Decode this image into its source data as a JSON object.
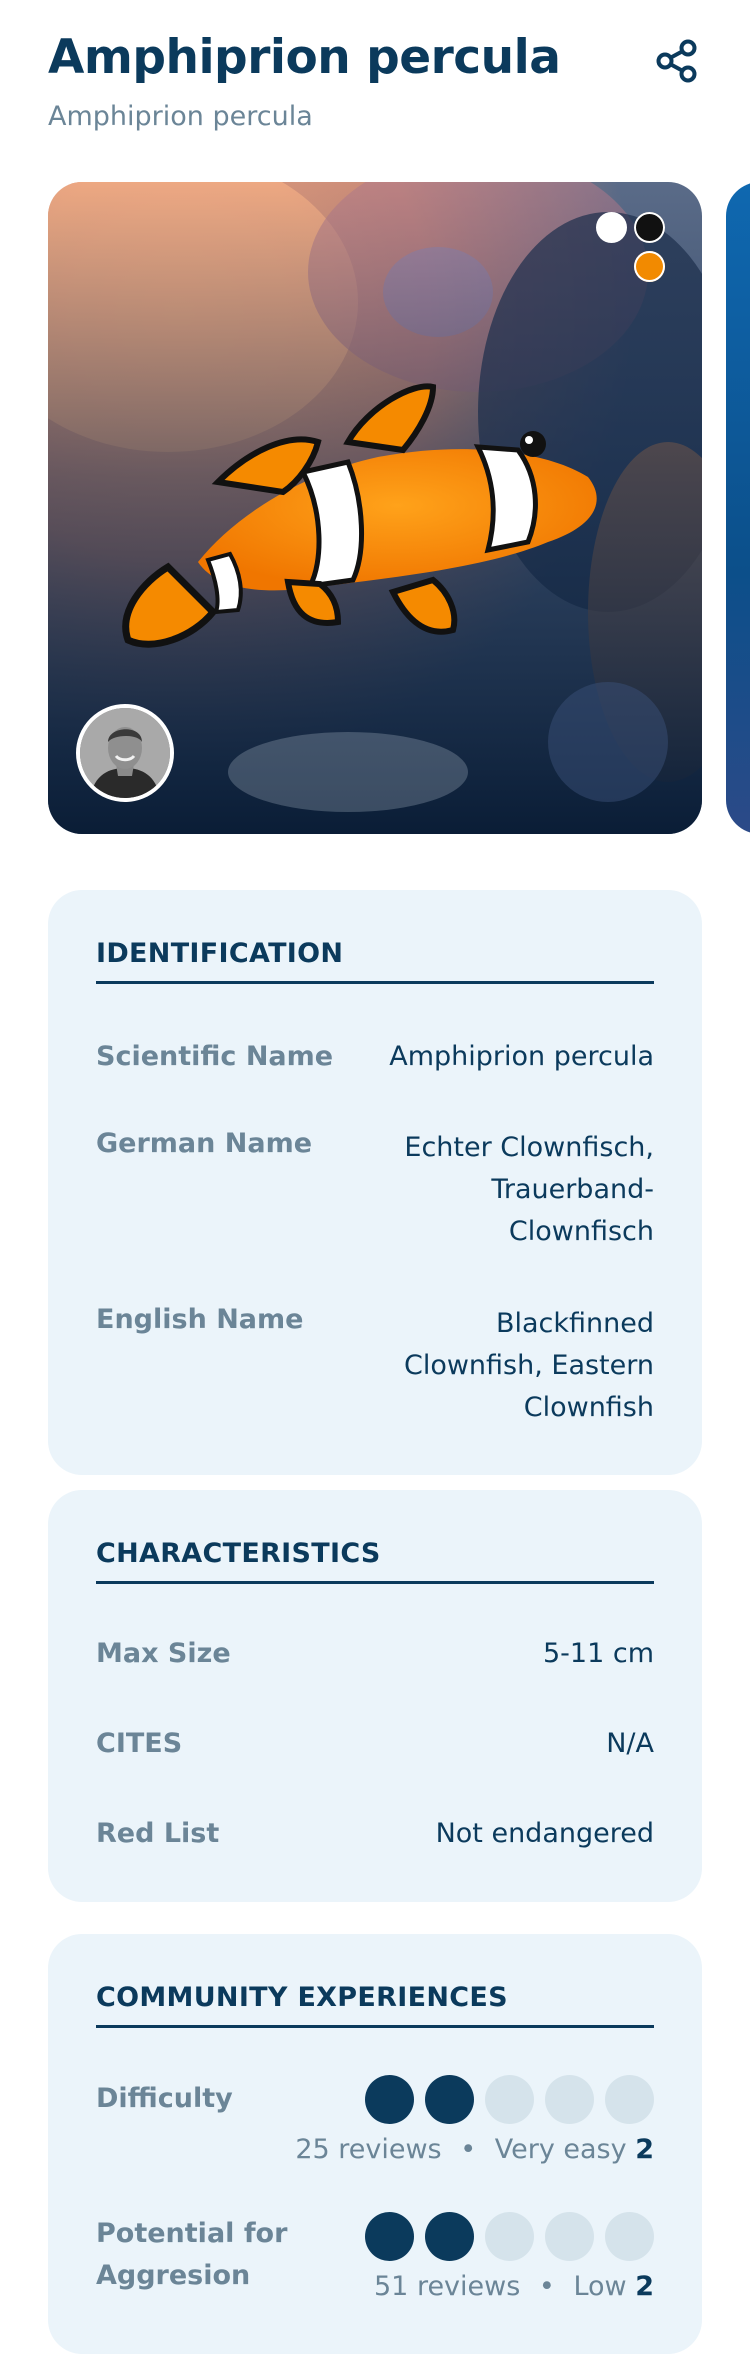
{
  "header": {
    "title": "Amphiprion percula",
    "subtitle": "Amphiprion percula"
  },
  "gallery": {
    "dots": [
      "white",
      "black",
      "orange"
    ]
  },
  "identification": {
    "title": "IDENTIFICATION",
    "rows": [
      {
        "label": "Scientific Name",
        "value": "Amphiprion percula"
      },
      {
        "label": "German Name",
        "value_lines": [
          "Echter Clownfisch,",
          "Trauerband-",
          "Clownfisch"
        ]
      },
      {
        "label": "English Name",
        "value_lines": [
          "Blackfinned",
          "Clownfish, Eastern",
          "Clownfish"
        ]
      }
    ]
  },
  "characteristics": {
    "title": "CHARACTERISTICS",
    "rows": [
      {
        "label": "Max Size",
        "value": "5-11 cm"
      },
      {
        "label": "CITES",
        "value": "N/A"
      },
      {
        "label": "Red List",
        "value": "Not endangered"
      }
    ]
  },
  "community": {
    "title": "COMMUNITY EXPERIENCES",
    "rows": [
      {
        "label": "Difficulty",
        "rating": 2,
        "max": 5,
        "reviews": "25 reviews",
        "sep": "•",
        "verdict": "Very easy",
        "score": "2"
      },
      {
        "label_lines": [
          "Potential for",
          "Aggresion"
        ],
        "rating": 2,
        "max": 5,
        "reviews": "51 reviews",
        "sep": "•",
        "verdict": "Low",
        "score": "2"
      }
    ]
  },
  "colors": {
    "primary": "#0b3a5c",
    "muted": "#6b8597",
    "card_bg": "#ebf4fa",
    "dot_off": "#d5e3eb",
    "accent_orange": "#f28a00"
  }
}
